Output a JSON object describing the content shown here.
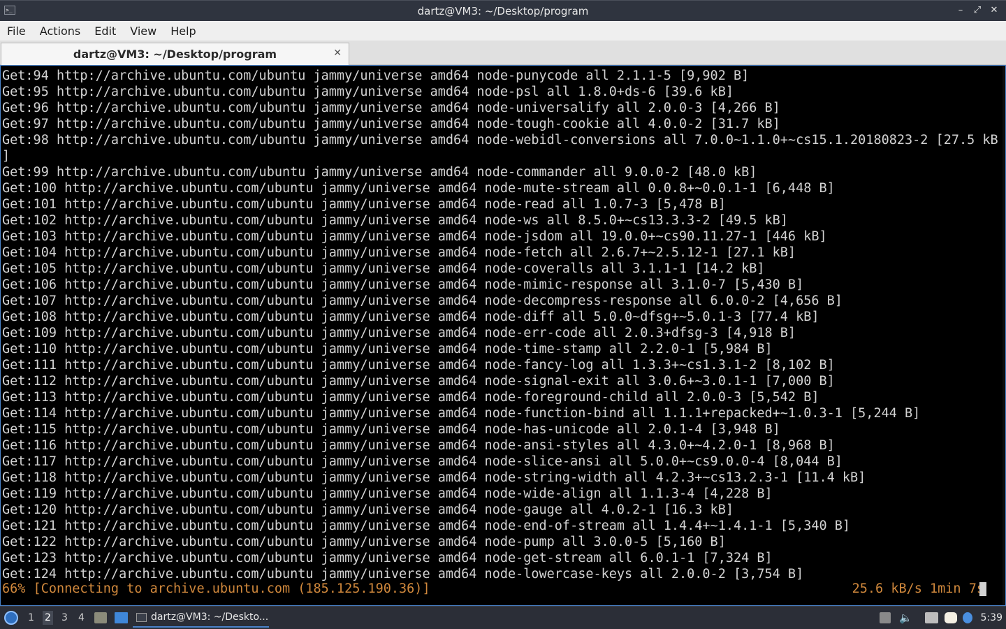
{
  "window": {
    "title": "dartz@VM3: ~/Desktop/program",
    "app_icon": ">_",
    "controls": [
      "–",
      "⤢",
      "✕"
    ]
  },
  "menu": [
    "File",
    "Actions",
    "Edit",
    "View",
    "Help"
  ],
  "tab": {
    "label": "dartz@VM3: ~/Desktop/program",
    "close": "✕"
  },
  "terminal": {
    "lines": [
      "Get:94 http://archive.ubuntu.com/ubuntu jammy/universe amd64 node-punycode all 2.1.1-5 [9,902 B]",
      "Get:95 http://archive.ubuntu.com/ubuntu jammy/universe amd64 node-psl all 1.8.0+ds-6 [39.6 kB]",
      "Get:96 http://archive.ubuntu.com/ubuntu jammy/universe amd64 node-universalify all 2.0.0-3 [4,266 B]",
      "Get:97 http://archive.ubuntu.com/ubuntu jammy/universe amd64 node-tough-cookie all 4.0.0-2 [31.7 kB]",
      "Get:98 http://archive.ubuntu.com/ubuntu jammy/universe amd64 node-webidl-conversions all 7.0.0~1.1.0+~cs15.1.20180823-2 [27.5 kB",
      "]",
      "Get:99 http://archive.ubuntu.com/ubuntu jammy/universe amd64 node-commander all 9.0.0-2 [48.0 kB]",
      "Get:100 http://archive.ubuntu.com/ubuntu jammy/universe amd64 node-mute-stream all 0.0.8+~0.0.1-1 [6,448 B]",
      "Get:101 http://archive.ubuntu.com/ubuntu jammy/universe amd64 node-read all 1.0.7-3 [5,478 B]",
      "Get:102 http://archive.ubuntu.com/ubuntu jammy/universe amd64 node-ws all 8.5.0+~cs13.3.3-2 [49.5 kB]",
      "Get:103 http://archive.ubuntu.com/ubuntu jammy/universe amd64 node-jsdom all 19.0.0+~cs90.11.27-1 [446 kB]",
      "Get:104 http://archive.ubuntu.com/ubuntu jammy/universe amd64 node-fetch all 2.6.7+~2.5.12-1 [27.1 kB]",
      "Get:105 http://archive.ubuntu.com/ubuntu jammy/universe amd64 node-coveralls all 3.1.1-1 [14.2 kB]",
      "Get:106 http://archive.ubuntu.com/ubuntu jammy/universe amd64 node-mimic-response all 3.1.0-7 [5,430 B]",
      "Get:107 http://archive.ubuntu.com/ubuntu jammy/universe amd64 node-decompress-response all 6.0.0-2 [4,656 B]",
      "Get:108 http://archive.ubuntu.com/ubuntu jammy/universe amd64 node-diff all 5.0.0~dfsg+~5.0.1-3 [77.4 kB]",
      "Get:109 http://archive.ubuntu.com/ubuntu jammy/universe amd64 node-err-code all 2.0.3+dfsg-3 [4,918 B]",
      "Get:110 http://archive.ubuntu.com/ubuntu jammy/universe amd64 node-time-stamp all 2.2.0-1 [5,984 B]",
      "Get:111 http://archive.ubuntu.com/ubuntu jammy/universe amd64 node-fancy-log all 1.3.3+~cs1.3.1-2 [8,102 B]",
      "Get:112 http://archive.ubuntu.com/ubuntu jammy/universe amd64 node-signal-exit all 3.0.6+~3.0.1-1 [7,000 B]",
      "Get:113 http://archive.ubuntu.com/ubuntu jammy/universe amd64 node-foreground-child all 2.0.0-3 [5,542 B]",
      "Get:114 http://archive.ubuntu.com/ubuntu jammy/universe amd64 node-function-bind all 1.1.1+repacked+~1.0.3-1 [5,244 B]",
      "Get:115 http://archive.ubuntu.com/ubuntu jammy/universe amd64 node-has-unicode all 2.0.1-4 [3,948 B]",
      "Get:116 http://archive.ubuntu.com/ubuntu jammy/universe amd64 node-ansi-styles all 4.3.0+~4.2.0-1 [8,968 B]",
      "Get:117 http://archive.ubuntu.com/ubuntu jammy/universe amd64 node-slice-ansi all 5.0.0+~cs9.0.0-4 [8,044 B]",
      "Get:118 http://archive.ubuntu.com/ubuntu jammy/universe amd64 node-string-width all 4.2.3+~cs13.2.3-1 [11.4 kB]",
      "Get:119 http://archive.ubuntu.com/ubuntu jammy/universe amd64 node-wide-align all 1.1.3-4 [4,228 B]",
      "Get:120 http://archive.ubuntu.com/ubuntu jammy/universe amd64 node-gauge all 4.0.2-1 [16.3 kB]",
      "Get:121 http://archive.ubuntu.com/ubuntu jammy/universe amd64 node-end-of-stream all 1.4.4+~1.4.1-1 [5,340 B]",
      "Get:122 http://archive.ubuntu.com/ubuntu jammy/universe amd64 node-pump all 3.0.0-5 [5,160 B]",
      "Get:123 http://archive.ubuntu.com/ubuntu jammy/universe amd64 node-get-stream all 6.0.1-1 [7,324 B]",
      "Get:124 http://archive.ubuntu.com/ubuntu jammy/universe amd64 node-lowercase-keys all 2.0.0-2 [3,754 B]"
    ],
    "status_left": "66% [Connecting to archive.ubuntu.com (185.125.190.36)]",
    "status_right": "25.6 kB/s 1min 7s",
    "text_color": "#d2d2d2",
    "status_color": "#d0883c"
  },
  "taskbar": {
    "workspaces": [
      "1",
      "2",
      "3",
      "4"
    ],
    "active_workspace": "2",
    "task_label": "dartz@VM3: ~/Deskto...",
    "tray_icons": [
      "keyboard-icon",
      "volume-icon",
      "network-icon",
      "clipboard-icon",
      "update-icon"
    ],
    "clock": "5:39"
  }
}
